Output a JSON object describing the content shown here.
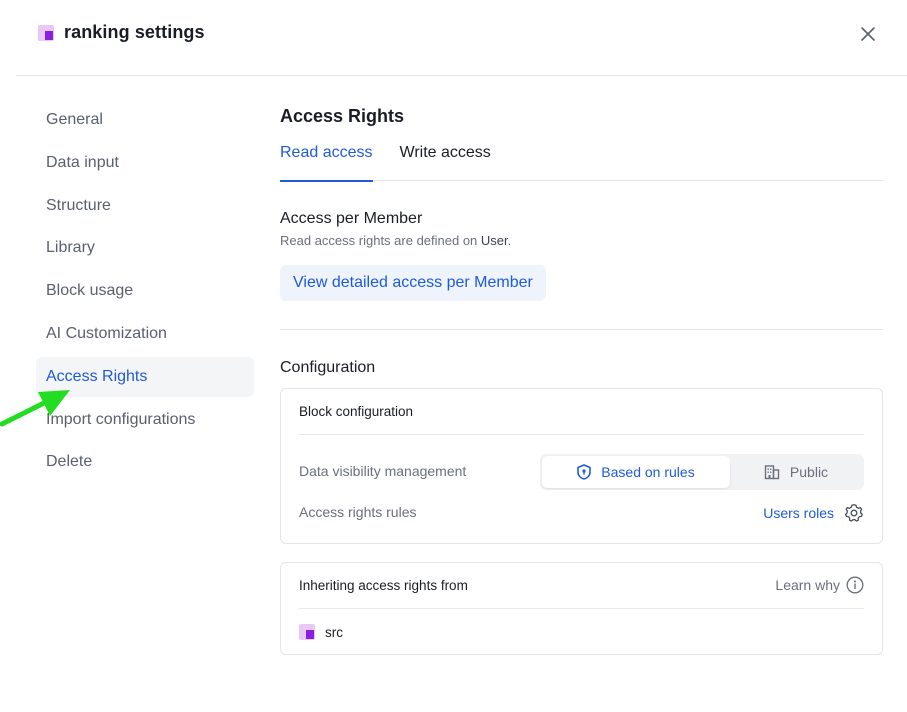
{
  "header": {
    "title": "ranking settings",
    "icon": "block-icon",
    "close_icon": "close-icon"
  },
  "sidebar": {
    "items": [
      {
        "label": "General",
        "active": false
      },
      {
        "label": "Data input",
        "active": false
      },
      {
        "label": "Structure",
        "active": false
      },
      {
        "label": "Library",
        "active": false
      },
      {
        "label": "Block usage",
        "active": false
      },
      {
        "label": "AI Customization",
        "active": false
      },
      {
        "label": "Access Rights",
        "active": true
      },
      {
        "label": "Import configurations",
        "active": false
      },
      {
        "label": "Delete",
        "active": false
      }
    ]
  },
  "main": {
    "title": "Access Rights",
    "tabs": [
      {
        "label": "Read access",
        "active": true
      },
      {
        "label": "Write access",
        "active": false
      }
    ],
    "access_per_member": {
      "title": "Access per Member",
      "desc_prefix": "Read access rights are defined on ",
      "desc_strong": "User",
      "desc_suffix": ".",
      "button": "View detailed access per Member"
    },
    "configuration": {
      "title": "Configuration",
      "block_configuration": {
        "title": "Block configuration",
        "visibility_label": "Data visibility management",
        "visibility_options": [
          {
            "label": "Based on rules",
            "icon": "shield-icon",
            "selected": true
          },
          {
            "label": "Public",
            "icon": "building-icon",
            "selected": false
          }
        ],
        "rules_label": "Access rights rules",
        "rules_link": "Users roles",
        "rules_icon": "gear-icon"
      },
      "inheriting": {
        "title": "Inheriting access rights from",
        "learn_why": "Learn why",
        "learn_icon": "info-icon",
        "source": "src"
      }
    }
  },
  "colors": {
    "accent": "#1f5bd8",
    "brand_icon": "#8a2be2",
    "annotation_arrow": "#22dd22"
  }
}
